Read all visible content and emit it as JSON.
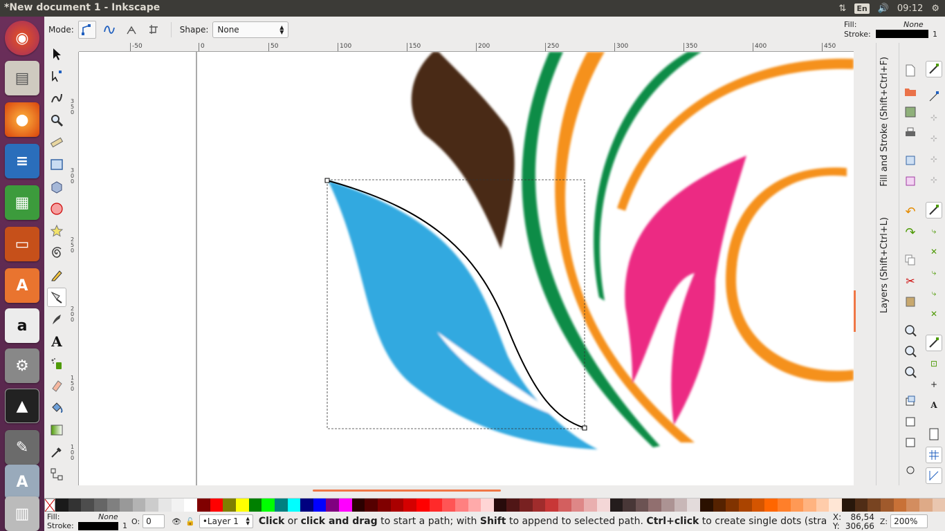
{
  "window": {
    "title": "*New document 1 - Inkscape"
  },
  "tray": {
    "lang": "En",
    "time": "09:12"
  },
  "toolctl": {
    "mode_label": "Mode:",
    "shape_label": "Shape:",
    "shape_value": "None"
  },
  "style_indicator_top": {
    "fill_label": "Fill:",
    "fill_value": "None",
    "stroke_label": "Stroke:",
    "stroke_width": "1",
    "stroke_color": "#000000"
  },
  "hruler": {
    "ticks": [
      "-50",
      "0",
      "50",
      "100",
      "150",
      "200",
      "250",
      "300",
      "350",
      "400",
      "450"
    ]
  },
  "vruler": {
    "ticks": [
      "350",
      "300",
      "250",
      "200",
      "150",
      "100"
    ]
  },
  "dock": {
    "fill_stroke_tab": "Fill and Stroke (Shift+Ctrl+F)",
    "layers_tab": "Layers (Shift+Ctrl+L)"
  },
  "palette": {
    "colors": [
      "#1a1a1a",
      "#333333",
      "#4d4d4d",
      "#666666",
      "#808080",
      "#999999",
      "#b3b3b3",
      "#cccccc",
      "#e6e6e6",
      "#f2f2f2",
      "#ffffff",
      "#800000",
      "#ff0000",
      "#808000",
      "#ffff00",
      "#008000",
      "#00ff00",
      "#008080",
      "#00ffff",
      "#000080",
      "#0000ff",
      "#800080",
      "#ff00ff",
      "#2b0000",
      "#550000",
      "#800000",
      "#aa0000",
      "#d40000",
      "#ff0000",
      "#ff2a2a",
      "#ff5555",
      "#ff8080",
      "#ffaaaa",
      "#ffd5d5",
      "#280b0b",
      "#501616",
      "#782121",
      "#a02c2c",
      "#c83737",
      "#d35f5f",
      "#de8787",
      "#e9afaf",
      "#f4d7d7",
      "#241c1c",
      "#483737",
      "#6c5353",
      "#916f6f",
      "#ac9393",
      "#c8b7b7",
      "#e3dbdb",
      "#2b1100",
      "#552200",
      "#803300",
      "#aa4400",
      "#d45500",
      "#ff6600",
      "#ff7f2a",
      "#ff9955",
      "#ffb380",
      "#ffccaa",
      "#ffe6d5",
      "#28170b",
      "#502d16",
      "#784421",
      "#a05a2c",
      "#c87137",
      "#d38d5f",
      "#deaa87",
      "#e9c6af"
    ]
  },
  "status": {
    "fill_label": "Fill:",
    "fill_value": "None",
    "stroke_label": "Stroke:",
    "stroke_width": "1",
    "opacity_label": "O:",
    "opacity_value": "0",
    "layer": "•Layer 1",
    "msg_1": "Click",
    "msg_2": " or ",
    "msg_3": "click and drag",
    "msg_4": " to start a path; with ",
    "msg_5": "Shift",
    "msg_6": " to append to selected path. ",
    "msg_7": "Ctrl+click",
    "msg_8": " to create single dots (straight lin...",
    "x_label": "X:",
    "x_value": "86,54",
    "y_label": "Y:",
    "y_value": "306,66",
    "zoom_label": "Z:",
    "zoom_value": "200%"
  }
}
